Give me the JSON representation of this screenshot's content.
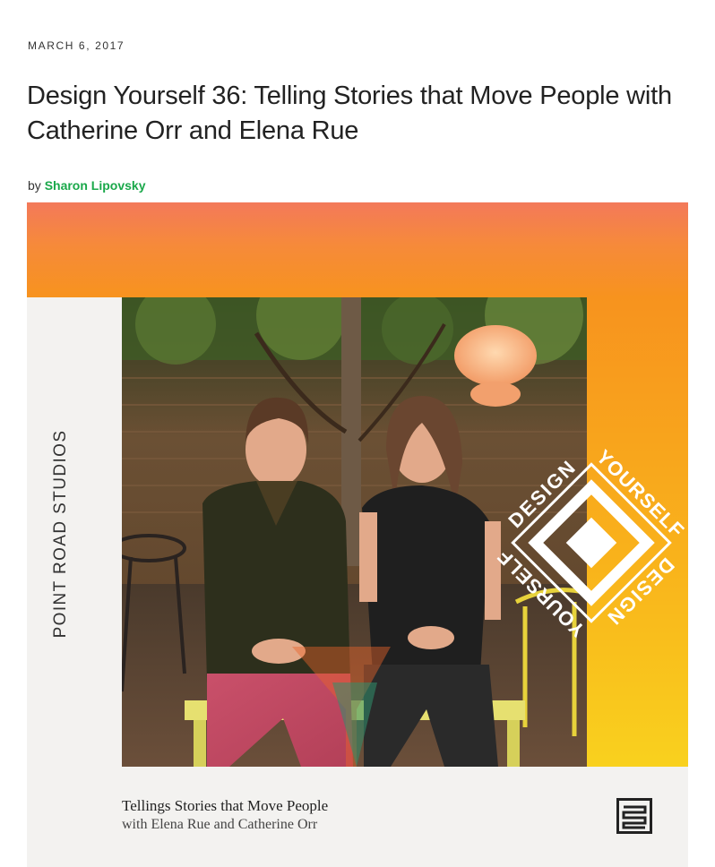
{
  "post": {
    "date": "MARCH 6, 2017",
    "title": "Design Yourself 36: Telling Stories that Move People with Catherine Orr and Elena Rue",
    "by_label": "by",
    "author": "Sharon Lipovsky"
  },
  "hero": {
    "studio": "POINT ROAD STUDIOS",
    "caption_title": "Tellings Stories that Move People",
    "caption_sub": "with Elena Rue and Catherine Orr",
    "badge_top": "YOURSELF",
    "badge_bottom": "YOURSELF",
    "badge_left": "DESIGN",
    "badge_right": "DESIGN",
    "colors": {
      "orange": "#f7931e",
      "yellow": "#f9d11e",
      "coral": "#f3795a",
      "link_green": "#1aa84a"
    }
  }
}
